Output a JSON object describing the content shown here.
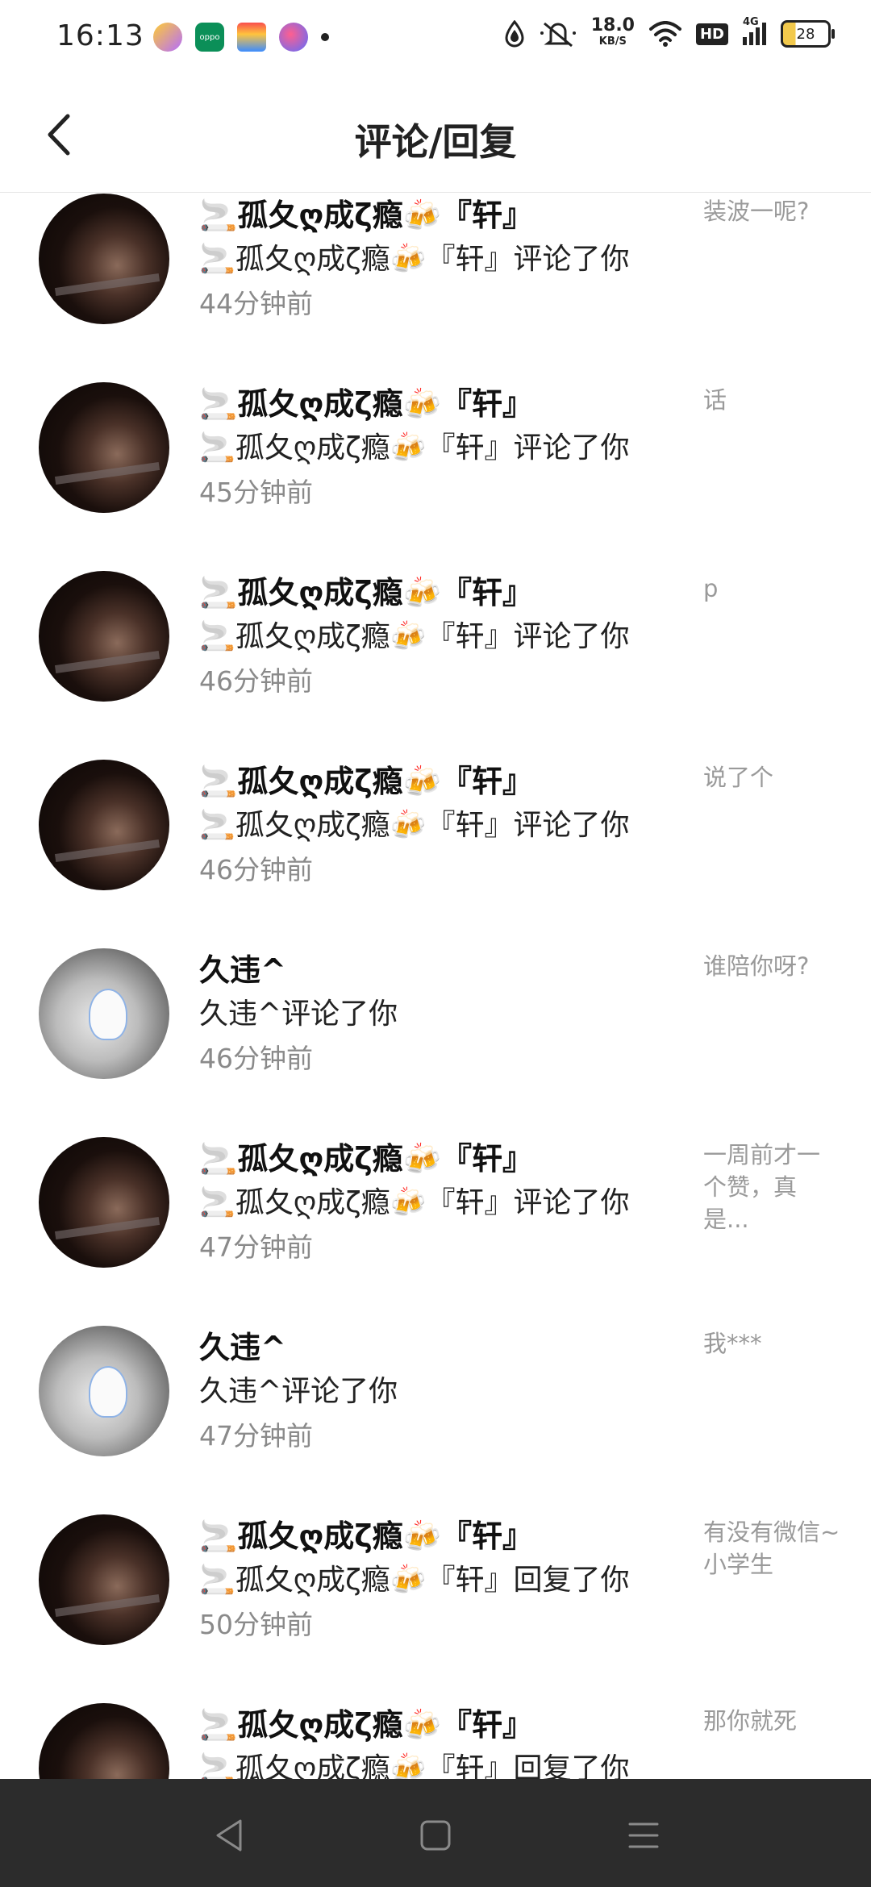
{
  "status_bar": {
    "time": "16:13",
    "net_speed": "18.0",
    "net_unit": "KB/S",
    "hd": "HD",
    "network": "4G",
    "battery": "28",
    "colors": {
      "battery_fill": "#f2c94c"
    }
  },
  "header": {
    "title": "评论/回复",
    "back_icon": "chevron-left-icon"
  },
  "notifications": [
    {
      "avatar": "dark",
      "name": "🚬孤夂ღ成ζ瘾🍻『轩』",
      "action": "🚬孤夂ღ成ζ瘾🍻『轩』评论了你",
      "time": "44分钟前",
      "preview": "装波一呢?"
    },
    {
      "avatar": "dark",
      "name": "🚬孤夂ღ成ζ瘾🍻『轩』",
      "action": "🚬孤夂ღ成ζ瘾🍻『轩』评论了你",
      "time": "45分钟前",
      "preview": "话"
    },
    {
      "avatar": "dark",
      "name": "🚬孤夂ღ成ζ瘾🍻『轩』",
      "action": "🚬孤夂ღ成ζ瘾🍻『轩』评论了你",
      "time": "46分钟前",
      "preview": "p"
    },
    {
      "avatar": "dark",
      "name": "🚬孤夂ღ成ζ瘾🍻『轩』",
      "action": "🚬孤夂ღ成ζ瘾🍻『轩』评论了你",
      "time": "46分钟前",
      "preview": "说了个"
    },
    {
      "avatar": "light",
      "name": "久违^",
      "action": "久违^评论了你",
      "time": "46分钟前",
      "preview": "谁陪你呀?"
    },
    {
      "avatar": "dark",
      "name": "🚬孤夂ღ成ζ瘾🍻『轩』",
      "action": "🚬孤夂ღ成ζ瘾🍻『轩』评论了你",
      "time": "47分钟前",
      "preview": "一周前才一个赞，真是..."
    },
    {
      "avatar": "light",
      "name": "久违^",
      "action": "久违^评论了你",
      "time": "47分钟前",
      "preview": "我***"
    },
    {
      "avatar": "dark",
      "name": "🚬孤夂ღ成ζ瘾🍻『轩』",
      "action": "🚬孤夂ღ成ζ瘾🍻『轩』回复了你",
      "time": "50分钟前",
      "preview": "有没有微信~小学生"
    },
    {
      "avatar": "dark",
      "name": "🚬孤夂ღ成ζ瘾🍻『轩』",
      "action": "🚬孤夂ღ成ζ瘾🍻『轩』回复了你",
      "time": "",
      "preview": "那你就死"
    }
  ],
  "nav_bar": {
    "back": "triangle-back-icon",
    "home": "square-home-icon",
    "menu": "menu-lines-icon"
  }
}
